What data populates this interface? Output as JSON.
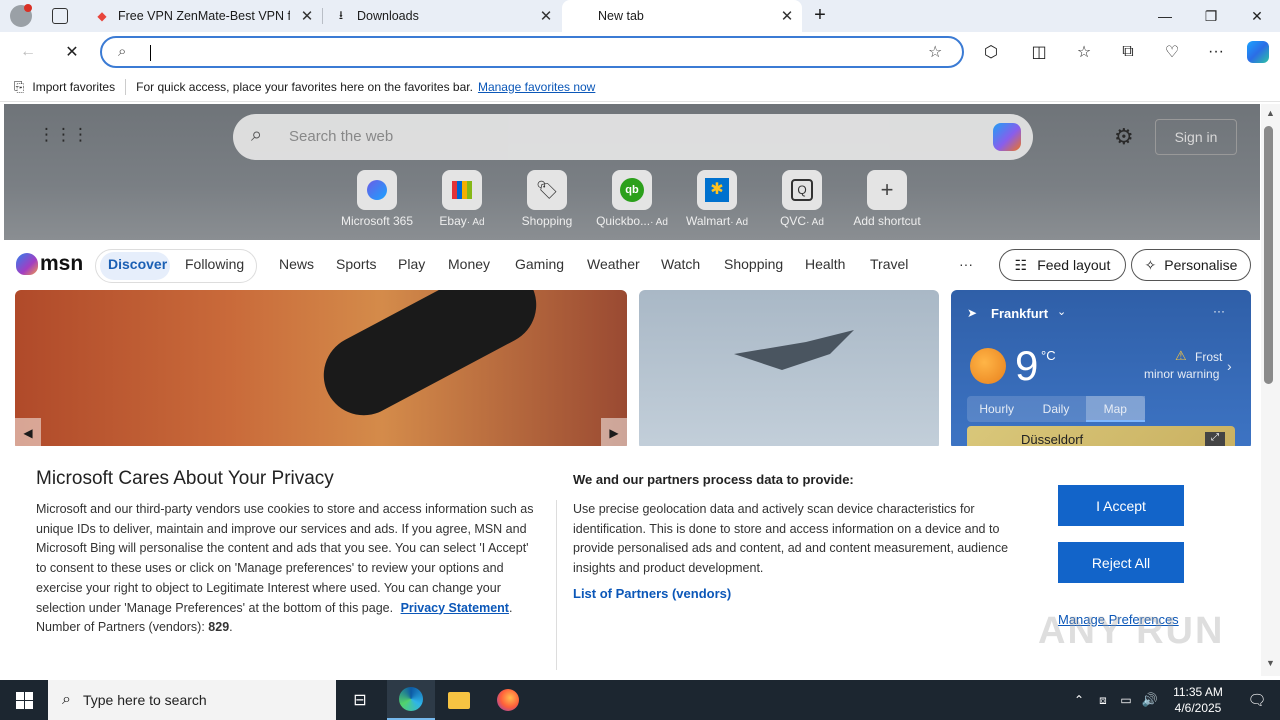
{
  "tabs": [
    {
      "title": "Free VPN ZenMate-Best VPN for"
    },
    {
      "title": "Downloads"
    },
    {
      "title": "New tab"
    }
  ],
  "favorites_bar": {
    "import_label": "Import favorites",
    "hint": "For quick access, place your favorites here on the favorites bar.",
    "manage_link": "Manage favorites now"
  },
  "msn": {
    "search_placeholder": "Search the web",
    "sign_in": "Sign in",
    "shortcuts": [
      {
        "label": "Microsoft 365",
        "ad": ""
      },
      {
        "label": "Ebay",
        "ad": "· Ad"
      },
      {
        "label": "Shopping",
        "ad": ""
      },
      {
        "label": "Quickbo...",
        "ad": "· Ad"
      },
      {
        "label": "Walmart",
        "ad": "· Ad"
      },
      {
        "label": "QVC",
        "ad": "· Ad"
      },
      {
        "label": "Add shortcut",
        "ad": ""
      }
    ],
    "logo": "msn",
    "nav": [
      "Discover",
      "Following",
      "News",
      "Sports",
      "Play",
      "Money",
      "Gaming",
      "Weather",
      "Watch",
      "Shopping",
      "Health",
      "Travel"
    ],
    "more": "···",
    "feed_layout": "Feed layout",
    "personalise": "Personalise",
    "weather": {
      "city": "Frankfurt",
      "temp": "9",
      "unit": "°C",
      "alert_title": "Frost",
      "alert_sub": "minor warning",
      "tabs": [
        "Hourly",
        "Daily",
        "Map"
      ],
      "map_label": "Düsseldorf"
    }
  },
  "privacy": {
    "title": "Microsoft Cares About Your Privacy",
    "body": "Microsoft and our third-party vendors use cookies to store and access information such as unique IDs to deliver, maintain and improve our services and ads. If you agree, MSN and Microsoft Bing will personalise the content and ads that you see. You can select 'I Accept' to consent to these uses or click on 'Manage preferences' to review your options and exercise your right to object to Legitimate Interest where used.  You can change your selection under 'Manage Preferences' at the bottom of this page.",
    "privacy_link": "Privacy Statement",
    "partners_count_label": "Number of Partners (vendors):",
    "partners_count": "829",
    "right_title": "We and our partners process data to provide:",
    "right_body": "Use precise geolocation data and actively scan device characteristics for identification. This is done to store and access information on a device and to provide personalised ads and content, ad and content measurement, audience insights and product development.",
    "partners_link": "List of Partners (vendors)",
    "accept": "I Accept",
    "reject": "Reject All",
    "manage": "Manage Preferences"
  },
  "taskbar": {
    "search_placeholder": "Type here to search",
    "time": "11:35 AM",
    "date": "4/6/2025"
  },
  "watermark": "ANY RUN"
}
